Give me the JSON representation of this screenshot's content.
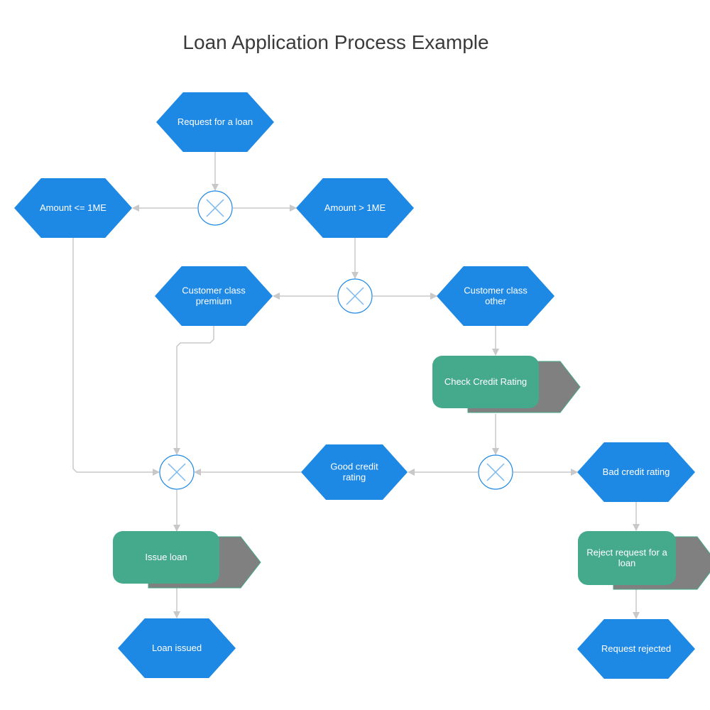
{
  "title": "Loan Application Process Example",
  "colors": {
    "event": "#1e88e5",
    "function": "#45aa8c",
    "function_shadow": "#808080",
    "connector": "#c8c8c8",
    "gateway_stroke": "#1e88e5",
    "gateway_x": "#7ab8ee"
  },
  "nodes": {
    "request_loan": {
      "type": "event",
      "label": [
        "Request for a loan"
      ]
    },
    "amount_le": {
      "type": "event",
      "label": [
        "Amount <= 1ME"
      ]
    },
    "amount_gt": {
      "type": "event",
      "label": [
        "Amount > 1ME"
      ]
    },
    "class_premium": {
      "type": "event",
      "label": [
        "Customer class",
        "premium"
      ]
    },
    "class_other": {
      "type": "event",
      "label": [
        "Customer class",
        "other"
      ]
    },
    "check_credit": {
      "type": "function",
      "label": [
        "Check Credit Rating"
      ]
    },
    "good_credit": {
      "type": "event",
      "label": [
        "Good credit",
        "rating"
      ]
    },
    "bad_credit": {
      "type": "event",
      "label": [
        "Bad credit rating"
      ]
    },
    "issue_loan": {
      "type": "function",
      "label": [
        "Issue loan"
      ]
    },
    "reject_request": {
      "type": "function",
      "label": [
        "Reject request for a",
        "loan"
      ]
    },
    "loan_issued": {
      "type": "event",
      "label": [
        "Loan issued"
      ]
    },
    "request_rejected": {
      "type": "event",
      "label": [
        "Request rejected"
      ]
    }
  },
  "gateways": [
    "xor-amount",
    "xor-class",
    "xor-credit",
    "xor-join"
  ],
  "edges": [
    [
      "request_loan",
      "xor-amount"
    ],
    [
      "xor-amount",
      "amount_le"
    ],
    [
      "xor-amount",
      "amount_gt"
    ],
    [
      "amount_gt",
      "xor-class"
    ],
    [
      "xor-class",
      "class_premium"
    ],
    [
      "xor-class",
      "class_other"
    ],
    [
      "class_other",
      "check_credit"
    ],
    [
      "check_credit",
      "xor-credit"
    ],
    [
      "xor-credit",
      "good_credit"
    ],
    [
      "xor-credit",
      "bad_credit"
    ],
    [
      "good_credit",
      "xor-join"
    ],
    [
      "amount_le",
      "xor-join"
    ],
    [
      "class_premium",
      "xor-join"
    ],
    [
      "xor-join",
      "issue_loan"
    ],
    [
      "issue_loan",
      "loan_issued"
    ],
    [
      "bad_credit",
      "reject_request"
    ],
    [
      "reject_request",
      "request_rejected"
    ]
  ]
}
